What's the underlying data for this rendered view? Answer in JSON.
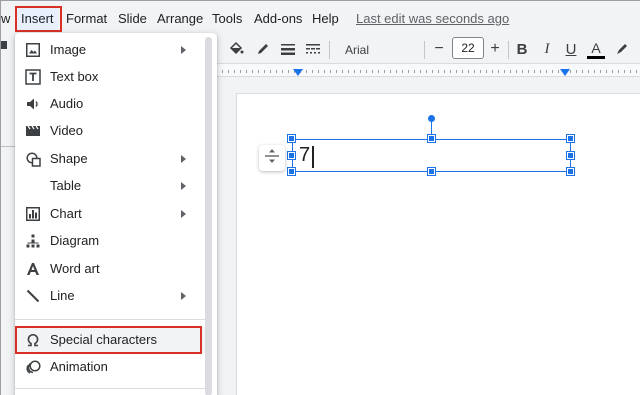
{
  "menubar": {
    "partial_item": "w",
    "items": [
      "Insert",
      "Format",
      "Slide",
      "Arrange",
      "Tools",
      "Add-ons",
      "Help"
    ],
    "last_edit": "Last edit was seconds ago"
  },
  "toolbar": {
    "font": "Arial",
    "font_size": "22",
    "minus": "−",
    "plus": "+",
    "bold": "B",
    "italic": "I",
    "underline": "U",
    "text_color": "A"
  },
  "slide": {
    "text": "7"
  },
  "insert_menu": {
    "items": [
      {
        "label": "Image",
        "icon": "image-icon",
        "submenu": true
      },
      {
        "label": "Text box",
        "icon": "text-box-icon",
        "submenu": false
      },
      {
        "label": "Audio",
        "icon": "audio-icon",
        "submenu": false
      },
      {
        "label": "Video",
        "icon": "video-icon",
        "submenu": false
      },
      {
        "label": "Shape",
        "icon": "shape-icon",
        "submenu": true
      },
      {
        "label": "Table",
        "icon": "",
        "submenu": true
      },
      {
        "label": "Chart",
        "icon": "chart-icon",
        "submenu": true
      },
      {
        "label": "Diagram",
        "icon": "diagram-icon",
        "submenu": false
      },
      {
        "label": "Word art",
        "icon": "word-art-icon",
        "submenu": false
      },
      {
        "label": "Line",
        "icon": "line-icon",
        "submenu": true
      }
    ],
    "special_characters": "Special characters",
    "animation": "Animation"
  },
  "colors": {
    "accent": "#1a73e8",
    "highlight_box": "#d93025",
    "menu_bg": "#f1f3f4"
  }
}
